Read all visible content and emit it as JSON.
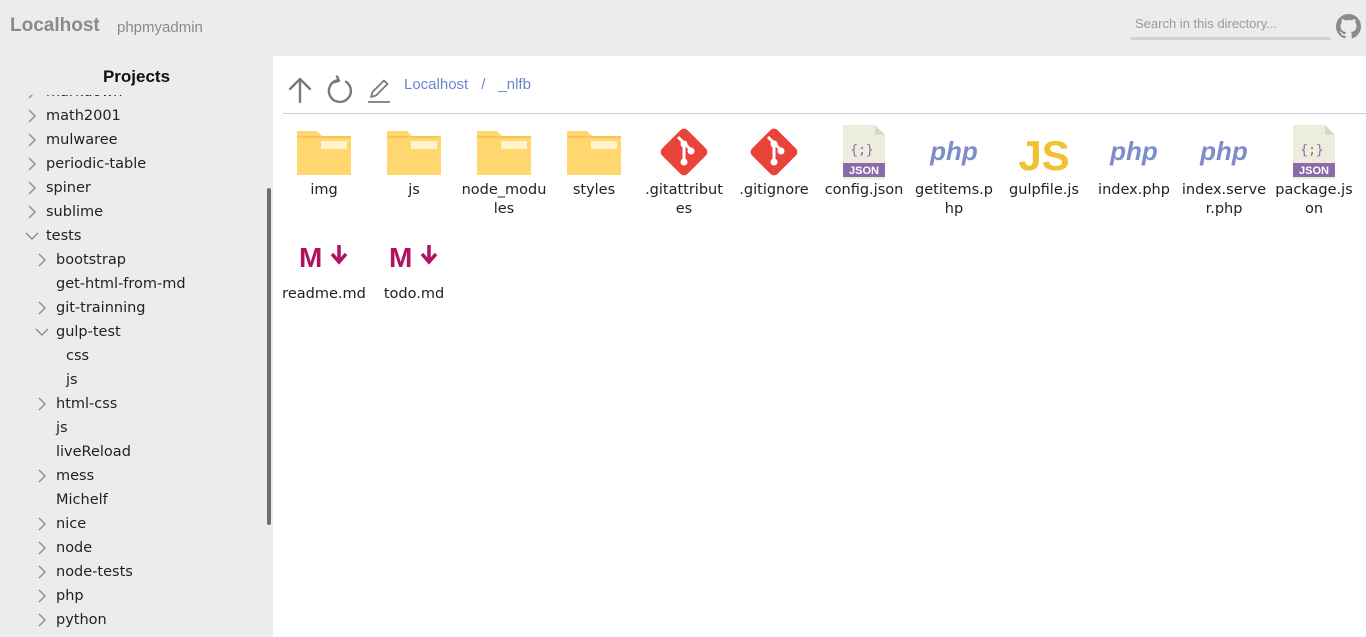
{
  "header": {
    "brand": "Localhost",
    "link": "phpmyadmin",
    "search_placeholder": "Search in this directory...",
    "github_icon": "github-icon"
  },
  "sidebar": {
    "title": "Projects",
    "items": [
      {
        "label": "markdown",
        "state": "collapsed",
        "depth": 0
      },
      {
        "label": "math2001",
        "state": "collapsed",
        "depth": 0
      },
      {
        "label": "mulwaree",
        "state": "collapsed",
        "depth": 0
      },
      {
        "label": "periodic-table",
        "state": "collapsed",
        "depth": 0
      },
      {
        "label": "spiner",
        "state": "collapsed",
        "depth": 0
      },
      {
        "label": "sublime",
        "state": "collapsed",
        "depth": 0
      },
      {
        "label": "tests",
        "state": "expanded",
        "depth": 0
      },
      {
        "label": "bootstrap",
        "state": "collapsed",
        "depth": 1
      },
      {
        "label": "get-html-from-md",
        "state": "none",
        "depth": 1
      },
      {
        "label": "git-trainning",
        "state": "collapsed",
        "depth": 1
      },
      {
        "label": "gulp-test",
        "state": "expanded",
        "depth": 1
      },
      {
        "label": "css",
        "state": "none",
        "depth": 2
      },
      {
        "label": "js",
        "state": "none",
        "depth": 2
      },
      {
        "label": "html-css",
        "state": "collapsed",
        "depth": 1
      },
      {
        "label": "js",
        "state": "none",
        "depth": 1
      },
      {
        "label": "liveReload",
        "state": "none",
        "depth": 1
      },
      {
        "label": "mess",
        "state": "collapsed",
        "depth": 1
      },
      {
        "label": "Michelf",
        "state": "none",
        "depth": 1
      },
      {
        "label": "nice",
        "state": "collapsed",
        "depth": 1
      },
      {
        "label": "node",
        "state": "collapsed",
        "depth": 1
      },
      {
        "label": "node-tests",
        "state": "collapsed",
        "depth": 1
      },
      {
        "label": "php",
        "state": "collapsed",
        "depth": 1
      },
      {
        "label": "python",
        "state": "collapsed",
        "depth": 1
      }
    ]
  },
  "toolbar": {
    "up_icon": "arrow-up-icon",
    "refresh_icon": "refresh-icon",
    "edit_icon": "pencil-icon"
  },
  "breadcrumb": {
    "items": [
      "Localhost",
      "_nlfb"
    ],
    "separator": "/"
  },
  "files": [
    {
      "name": "img",
      "type": "folder"
    },
    {
      "name": "js",
      "type": "folder"
    },
    {
      "name": "node_modules",
      "type": "folder"
    },
    {
      "name": "styles",
      "type": "folder"
    },
    {
      "name": ".gitattributes",
      "type": "git"
    },
    {
      "name": ".gitignore",
      "type": "git"
    },
    {
      "name": "config.json",
      "type": "json"
    },
    {
      "name": "getitems.php",
      "type": "php"
    },
    {
      "name": "gulpfile.js",
      "type": "js"
    },
    {
      "name": "index.php",
      "type": "php"
    },
    {
      "name": "index.server.php",
      "type": "php"
    },
    {
      "name": "package.json",
      "type": "json"
    },
    {
      "name": "readme.md",
      "type": "markdown"
    },
    {
      "name": "todo.md",
      "type": "markdown"
    }
  ],
  "colors": {
    "folder": "#ffd76e",
    "git": "#e8443a",
    "json_tag": "#8a6aa8",
    "php": "#7b8ec8",
    "js": "#f2c12e",
    "markdown": "#b0125f",
    "link": "#6b86c8"
  },
  "icon_text": {
    "json_tag": "JSON",
    "json_braces": "{;}",
    "php": "php",
    "js": "JS",
    "md": "M"
  }
}
